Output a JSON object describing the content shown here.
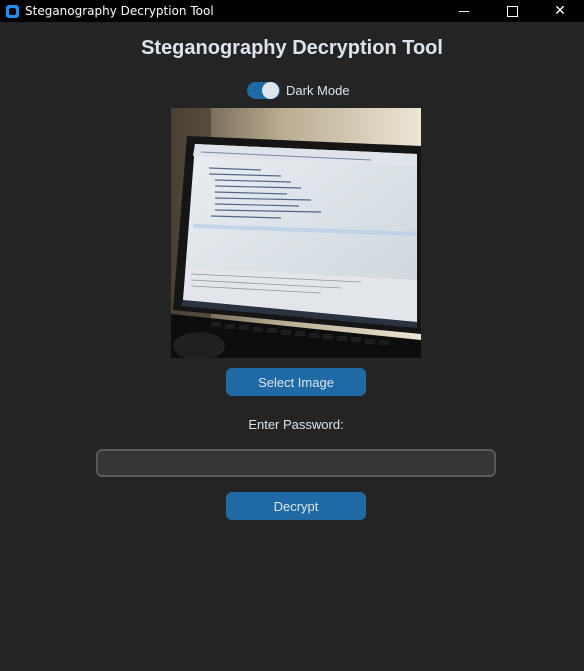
{
  "window": {
    "title": "Steganography Decryption Tool"
  },
  "header": {
    "title": "Steganography Decryption Tool"
  },
  "theme_switch": {
    "label": "Dark Mode",
    "on": true
  },
  "buttons": {
    "select_image": "Select Image",
    "decrypt": "Decrypt"
  },
  "password": {
    "label": "Enter Password:",
    "value": "",
    "placeholder": ""
  },
  "colors": {
    "background": "#242424",
    "accent": "#1f6aa5",
    "text": "#dce4ee",
    "input_bg": "#343638",
    "input_border": "#565b5e"
  }
}
